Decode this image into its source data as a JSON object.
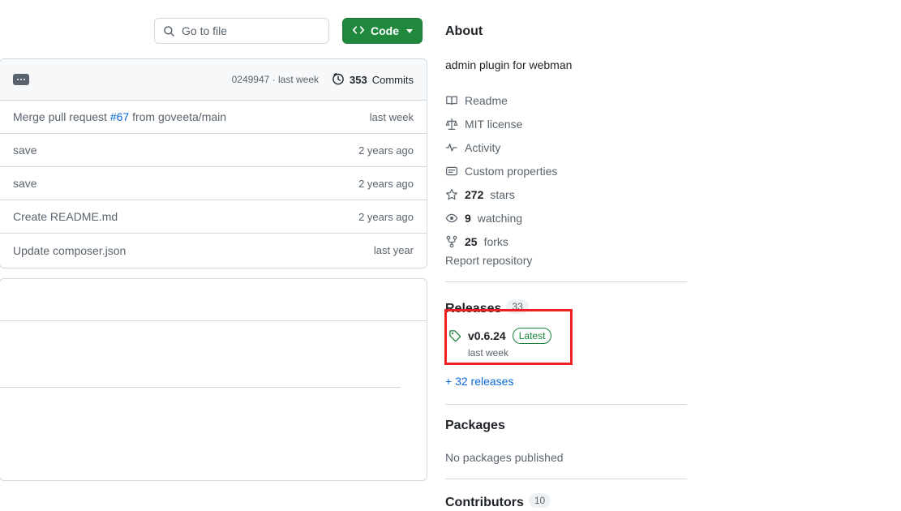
{
  "toolbar": {
    "search_placeholder": "Go to file",
    "search_value": "",
    "code_button_label": "Code"
  },
  "file_panel": {
    "commit_hash_time": "0249947 · last week",
    "commits_count": "353",
    "commits_label": "Commits",
    "commits": [
      {
        "message_prefix": "Merge pull request ",
        "message_link": "#67",
        "message_suffix": " from goveeta/main",
        "age": "last week"
      },
      {
        "message_prefix": "save",
        "message_link": "",
        "message_suffix": "",
        "age": "2 years ago"
      },
      {
        "message_prefix": "save",
        "message_link": "",
        "message_suffix": "",
        "age": "2 years ago"
      },
      {
        "message_prefix": "Create README.md",
        "message_link": "",
        "message_suffix": "",
        "age": "2 years ago"
      },
      {
        "message_prefix": "Update composer.json",
        "message_link": "",
        "message_suffix": "",
        "age": "last year"
      }
    ]
  },
  "sidebar": {
    "about": {
      "title": "About",
      "description": "admin plugin for webman",
      "links": [
        {
          "icon": "book-icon",
          "label": "Readme"
        },
        {
          "icon": "law-scale-icon",
          "label": "MIT license"
        },
        {
          "icon": "pulse-icon",
          "label": "Activity"
        },
        {
          "icon": "custom-properties-icon",
          "label": "Custom properties"
        }
      ],
      "stats": [
        {
          "icon": "star-icon",
          "count": "272",
          "label": "stars"
        },
        {
          "icon": "eye-icon",
          "count": "9",
          "label": "watching"
        },
        {
          "icon": "fork-icon",
          "count": "25",
          "label": "forks"
        }
      ],
      "report_label": "Report repository"
    },
    "releases": {
      "title": "Releases",
      "count": "33",
      "latest": {
        "version": "v0.6.24",
        "badge": "Latest",
        "time": "last week"
      },
      "more_link": "+ 32 releases"
    },
    "packages": {
      "title": "Packages",
      "empty_text": "No packages published"
    },
    "contributors": {
      "title": "Contributors",
      "count": "10"
    }
  },
  "annotation": {
    "highlight_color": "#ef2020"
  }
}
